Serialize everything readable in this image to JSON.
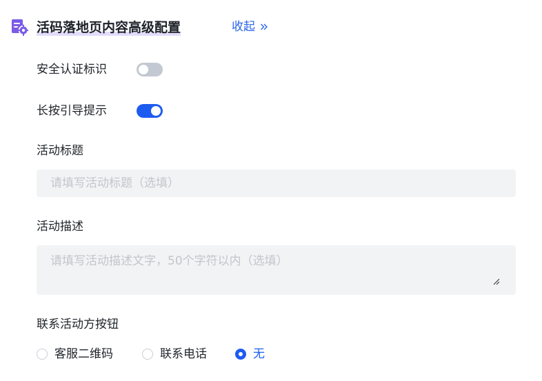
{
  "section": {
    "title": "活码落地页内容高级配置",
    "collapse_label": "收起",
    "icon": "document-settings-icon",
    "accent": "#7b5ce6"
  },
  "security_badge": {
    "label": "安全认证标识",
    "enabled": false
  },
  "long_press_hint": {
    "label": "长按引导提示",
    "enabled": true
  },
  "activity_title": {
    "label": "活动标题",
    "value": "",
    "placeholder": "请填写活动标题（选填）"
  },
  "activity_desc": {
    "label": "活动描述",
    "value": "",
    "placeholder": "请填写活动描述文字，50个字符以内（选填）"
  },
  "contact_button": {
    "label": "联系活动方按钮",
    "options": [
      "客服二维码",
      "联系电话",
      "无"
    ],
    "selected": "无"
  },
  "colors": {
    "primary": "#1d5cf0",
    "link": "#2b64e9",
    "switch_off": "#c3c9d2",
    "input_bg": "#f2f3f5"
  }
}
